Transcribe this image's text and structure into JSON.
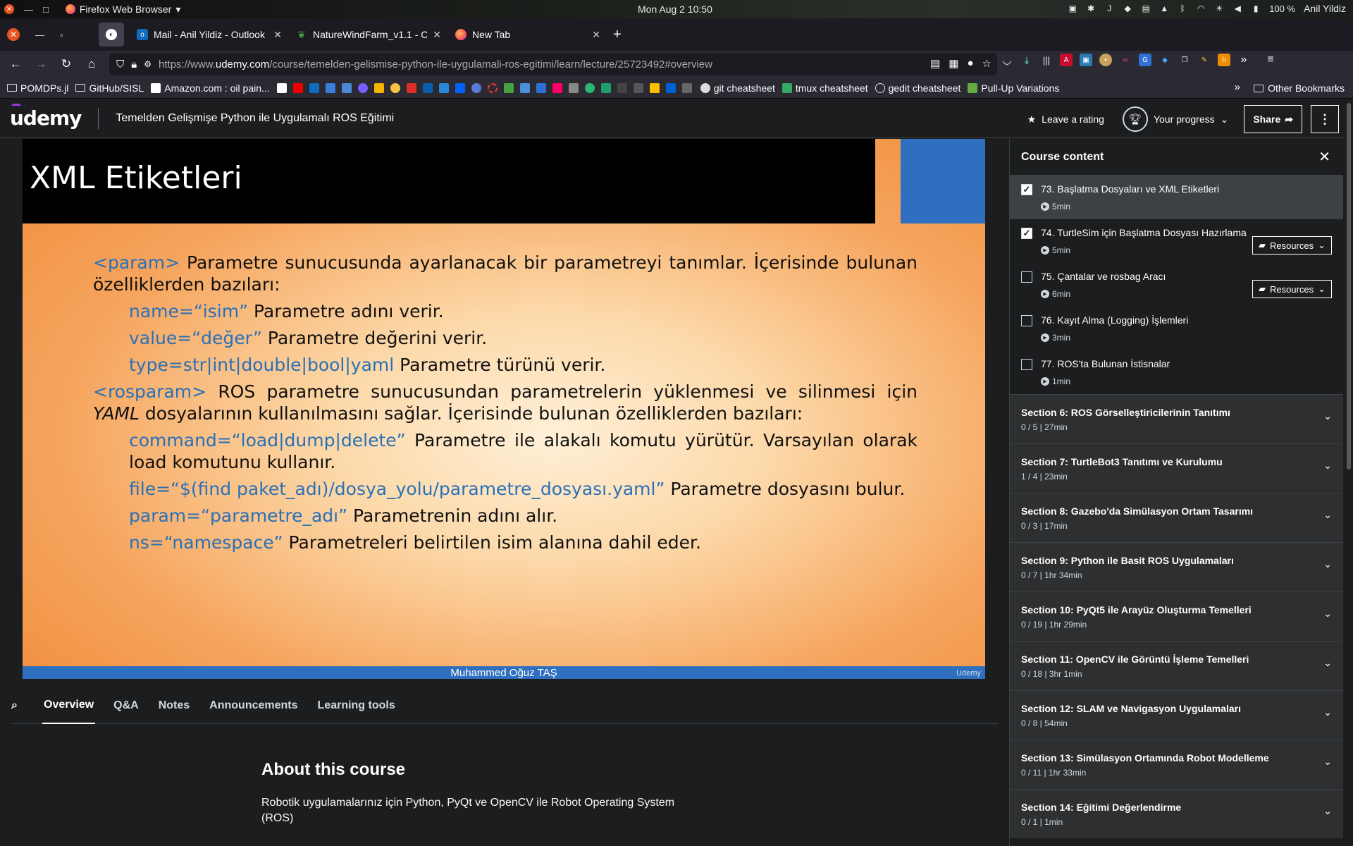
{
  "os": {
    "app_name": "Firefox Web Browser",
    "clock": "Mon Aug 2  10:50",
    "battery": "100 %",
    "user": "Anil Yildiz"
  },
  "tabs": [
    {
      "title": "Mail - Anil Yildiz - Outlook",
      "icon": "outlook-icon",
      "color": "#0f6cbd"
    },
    {
      "title": "NatureWindFarm_v1.1 - C",
      "icon": "overleaf-icon",
      "color": "#47a141"
    },
    {
      "title": "New Tab",
      "icon": "firefox-icon",
      "color": "#ff7139"
    }
  ],
  "nav": {
    "url_prefix": "https://www.",
    "url_domain": "udemy.com",
    "url_path": "/course/temelden-gelismise-python-ile-uygulamali-ros-egitimi/learn/lecture/25723492#overview"
  },
  "bookmarks": {
    "items": [
      "POMDPs.jl",
      "GitHub/SISL",
      "Amazon.com : oil pain...",
      "git cheatsheet",
      "tmux cheatsheet",
      "gedit cheatsheet",
      "Pull-Up Variations"
    ],
    "other": "Other Bookmarks"
  },
  "header": {
    "logo": "udemy",
    "course_title": "Temelden Gelişmişe Python ile Uygulamalı ROS Eğitimi",
    "leave_rating": "Leave a rating",
    "progress": "Your progress",
    "share": "Share"
  },
  "slide": {
    "title": "XML Etiketleri",
    "param_tag": "<param>",
    "param_desc": " Parametre sunucusunda ayarlanacak bir parametreyi tanımlar. İçerisinde bulunan özelliklerden bazıları:",
    "name_attr": "name=“isim”",
    "name_desc": " Parametre adını verir.",
    "value_attr": "value=“değer”",
    "value_desc": " Parametre değerini verir.",
    "type_attr": "type=str|int|double|bool|yaml",
    "type_desc": " Parametre türünü verir.",
    "rosparam_tag": "<rosparam>",
    "rosparam_desc": " ROS parametre sunucusundan parametrelerin yüklenmesi ve silinmesi için ",
    "rosparam_yaml": "YAML",
    "rosparam_desc2": " dosyalarının kullanılmasını sağlar. İçerisinde bulunan özelliklerden bazıları:",
    "command_attr": "command=“load|dump|delete”",
    "command_desc": " Parametre ile alakalı komutu yürütür. Varsayılan olarak load komutunu kullanır.",
    "file_attr": "file=“$(find paket_adı)/dosya_yolu/parametre_dosyası.yaml”",
    "file_desc": " Parametre dosyasını bulur.",
    "param_attr": "param=“parametre_adı”",
    "param_attr_desc": " Parametrenin adını alır.",
    "ns_attr": "ns=“namespace”",
    "ns_desc": " Parametreleri belirtilen isim alanına dahil eder.",
    "footer": "Muhammed Oğuz TAŞ",
    "footer_brand": "Udemy"
  },
  "lecture_tabs": [
    "Overview",
    "Q&A",
    "Notes",
    "Announcements",
    "Learning tools"
  ],
  "about": {
    "heading": "About this course",
    "text": "Robotik uygulamalarınız için Python, PyQt ve OpenCV ile Robot Operating System (ROS)"
  },
  "sidebar": {
    "title": "Course content",
    "lessons": [
      {
        "title": "73. Başlatma Dosyaları ve XML Etiketleri",
        "duration": "5min",
        "checked": true,
        "resources": ""
      },
      {
        "title": "74. TurtleSim için Başlatma Dosyası Hazırlama",
        "duration": "5min",
        "checked": true,
        "resources": "Resources"
      },
      {
        "title": "75. Çantalar ve rosbag Aracı",
        "duration": "6min",
        "checked": false,
        "resources": "Resources"
      },
      {
        "title": "76. Kayıt Alma (Logging) İşlemleri",
        "duration": "3min",
        "checked": false,
        "resources": ""
      },
      {
        "title": "77. ROS'ta Bulunan İstisnalar",
        "duration": "1min",
        "checked": false,
        "resources": ""
      }
    ],
    "sections": [
      {
        "title": "Section 6: ROS Görselleştiricilerinin Tanıtımı",
        "meta": "0 / 5 | 27min"
      },
      {
        "title": "Section 7: TurtleBot3 Tanıtımı ve Kurulumu",
        "meta": "1 / 4 | 23min"
      },
      {
        "title": "Section 8: Gazebo'da Simülasyon Ortam Tasarımı",
        "meta": "0 / 3 | 17min"
      },
      {
        "title": "Section 9: Python ile Basit ROS Uygulamaları",
        "meta": "0 / 7 | 1hr 34min"
      },
      {
        "title": "Section 10: PyQt5 ile Arayüz Oluşturma Temelleri",
        "meta": "0 / 19 | 1hr 29min"
      },
      {
        "title": "Section 11: OpenCV ile Görüntü İşleme Temelleri",
        "meta": "0 / 18 | 3hr 1min"
      },
      {
        "title": "Section 12: SLAM ve Navigasyon Uygulamaları",
        "meta": "0 / 8 | 54min"
      },
      {
        "title": "Section 13: Simülasyon Ortamında Robot Modelleme",
        "meta": "0 / 11 | 1hr 33min"
      },
      {
        "title": "Section 14: Eğitimi Değerlendirme",
        "meta": "0 / 1 | 1min"
      }
    ]
  },
  "colors": {
    "accent": "#a435f0",
    "slide_blue": "#2970b8",
    "firefox_close": "#e95420"
  }
}
